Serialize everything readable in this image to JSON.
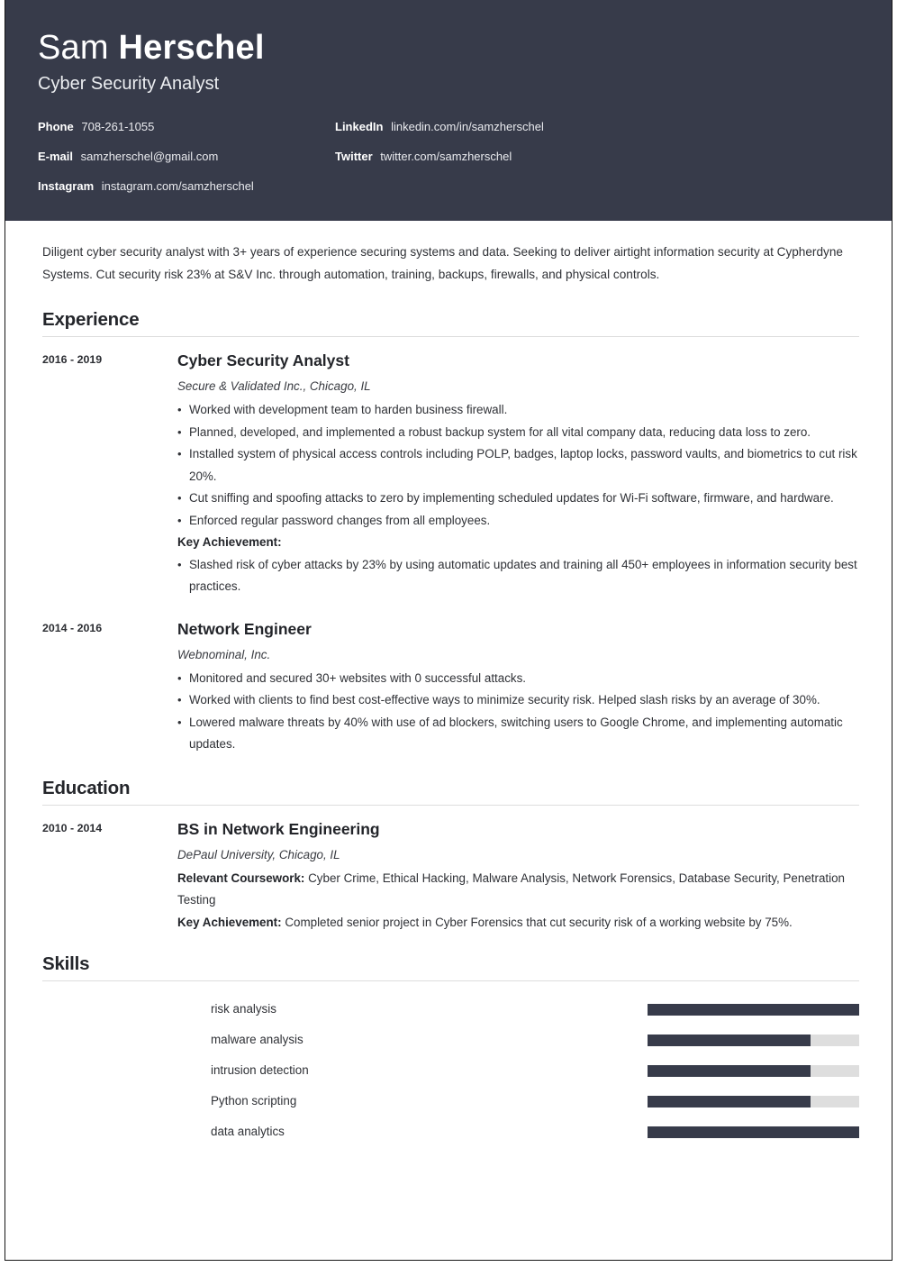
{
  "colors": {
    "header_bg": "#373b4a",
    "accent_dark": "#373b4a",
    "track": "#dedede",
    "text": "#2f3136",
    "rule": "#dddddd"
  },
  "header": {
    "first_name": "Sam",
    "last_name": "Herschel",
    "job_title": "Cyber Security Analyst",
    "contacts_left": [
      {
        "label": "Phone",
        "value": "708-261-1055"
      },
      {
        "label": "E-mail",
        "value": "samzherschel@gmail.com"
      },
      {
        "label": "Instagram",
        "value": "instagram.com/samzherschel"
      }
    ],
    "contacts_right": [
      {
        "label": "LinkedIn",
        "value": "linkedin.com/in/samzherschel"
      },
      {
        "label": "Twitter",
        "value": "twitter.com/samzherschel"
      }
    ]
  },
  "summary": "Diligent cyber security analyst with 3+ years of experience securing systems and data. Seeking to deliver airtight information security at Cypherdyne Systems. Cut security risk 23% at S&V Inc. through automation, training, backups, firewalls, and physical controls.",
  "experience": {
    "section_title": "Experience",
    "entries": [
      {
        "dates": "2016 - 2019",
        "title": "Cyber Security Analyst",
        "subtitle": "Secure & Validated Inc., Chicago, IL",
        "bullets": [
          "Worked with development team to harden business firewall.",
          "Planned, developed, and implemented a robust backup system for all vital company data, reducing data loss to zero.",
          "Installed system of physical access controls including POLP, badges, laptop locks, password vaults, and biometrics to cut risk 20%.",
          "Cut sniffing and spoofing attacks to zero by implementing scheduled updates for Wi-Fi software, firmware, and hardware.",
          "Enforced regular password changes from all employees."
        ],
        "key_achievement_label": "Key Achievement:",
        "key_achievement_bullets": [
          "Slashed risk of cyber attacks by 23% by using automatic updates and training all 450+ employees in information security best practices."
        ]
      },
      {
        "dates": "2014 - 2016",
        "title": "Network Engineer",
        "subtitle": "Webnominal, Inc.",
        "bullets": [
          "Monitored and secured 30+ websites with 0 successful attacks.",
          "Worked with clients to find best cost-effective ways to minimize security risk. Helped slash risks by an average of 30%.",
          "Lowered malware threats by 40% with use of ad blockers, switching users to Google Chrome, and implementing automatic updates."
        ],
        "key_achievement_label": "",
        "key_achievement_bullets": []
      }
    ]
  },
  "education": {
    "section_title": "Education",
    "entries": [
      {
        "dates": "2010 - 2014",
        "title": "BS in Network Engineering",
        "subtitle": "DePaul University, Chicago, IL",
        "coursework_label": "Relevant Coursework:",
        "coursework_value": "Cyber Crime, Ethical Hacking, Malware Analysis, Network Forensics, Database Security, Penetration Testing",
        "achievement_label": "Key Achievement:",
        "achievement_value": "Completed senior project in Cyber Forensics that cut security risk of a working website by 75%."
      }
    ]
  },
  "skills": {
    "section_title": "Skills",
    "items": [
      {
        "name": "risk analysis",
        "level": 100
      },
      {
        "name": "malware analysis",
        "level": 77
      },
      {
        "name": "intrusion detection",
        "level": 77
      },
      {
        "name": "Python scripting",
        "level": 77
      },
      {
        "name": "data analytics",
        "level": 100
      }
    ]
  }
}
